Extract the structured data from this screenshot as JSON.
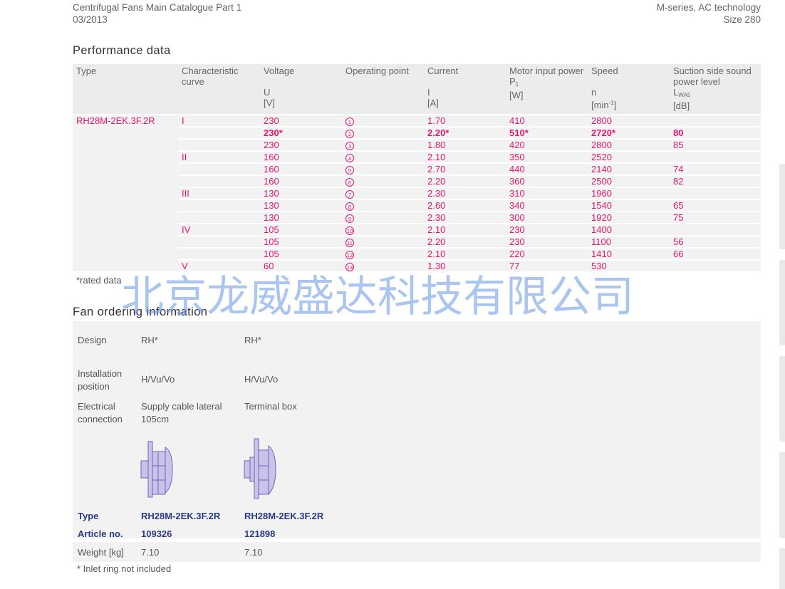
{
  "header": {
    "catalogue": "Centrifugal Fans Main Catalogue Part 1",
    "date": "03/2013",
    "series": "M-series, AC technology",
    "size": "Size 280"
  },
  "performance": {
    "title": "Performance data",
    "columns": {
      "type": "Type",
      "curve": "Characteristic curve",
      "voltage": {
        "label": "Voltage",
        "symbol": "U",
        "unit": "[V]"
      },
      "op": "Operating point",
      "current": {
        "label": "Current",
        "symbol": "I",
        "unit": "[A]"
      },
      "power": {
        "label": "Motor input power",
        "symbol": "P",
        "sub": "1",
        "unit": "[W]"
      },
      "speed": {
        "label": "Speed",
        "symbol": "n",
        "unit": "[min",
        "unit_sup": "-1",
        "unit_end": "]"
      },
      "sound": {
        "label": "Suction side sound power level",
        "symbol": "L",
        "sub": "WA5",
        "unit": "[dB]"
      }
    },
    "type_value": "RH28M-2EK.3F.2R",
    "rows": [
      {
        "curve": "I",
        "voltage": "230",
        "op": "1",
        "current": "1.70",
        "power": "410",
        "speed": "2800",
        "sound": ""
      },
      {
        "curve": "",
        "voltage": "230*",
        "op": "2",
        "current": "2.20*",
        "power": "510*",
        "speed": "2720*",
        "sound": "80",
        "bold": true
      },
      {
        "curve": "",
        "voltage": "230",
        "op": "3",
        "current": "1.80",
        "power": "420",
        "speed": "2800",
        "sound": "85"
      },
      {
        "curve": "II",
        "voltage": "160",
        "op": "4",
        "current": "2.10",
        "power": "350",
        "speed": "2520",
        "sound": ""
      },
      {
        "curve": "",
        "voltage": "160",
        "op": "5",
        "current": "2.70",
        "power": "440",
        "speed": "2140",
        "sound": "74"
      },
      {
        "curve": "",
        "voltage": "160",
        "op": "6",
        "current": "2.20",
        "power": "360",
        "speed": "2500",
        "sound": "82"
      },
      {
        "curve": "III",
        "voltage": "130",
        "op": "7",
        "current": "2.30",
        "power": "310",
        "speed": "1960",
        "sound": ""
      },
      {
        "curve": "",
        "voltage": "130",
        "op": "8",
        "current": "2.60",
        "power": "340",
        "speed": "1540",
        "sound": "65"
      },
      {
        "curve": "",
        "voltage": "130",
        "op": "9",
        "current": "2.30",
        "power": "300",
        "speed": "1920",
        "sound": "75"
      },
      {
        "curve": "IV",
        "voltage": "105",
        "op": "10",
        "current": "2.10",
        "power": "230",
        "speed": "1400",
        "sound": ""
      },
      {
        "curve": "",
        "voltage": "105",
        "op": "11",
        "current": "2.20",
        "power": "230",
        "speed": "1100",
        "sound": "56"
      },
      {
        "curve": "",
        "voltage": "105",
        "op": "12",
        "current": "2.10",
        "power": "220",
        "speed": "1410",
        "sound": "66"
      },
      {
        "curve": "V",
        "voltage": "60",
        "op": "13",
        "current": "1.30",
        "power": "77",
        "speed": "530",
        "sound": ""
      }
    ],
    "footnote": "*rated data"
  },
  "ordering": {
    "title": "Fan ordering information",
    "design_label": "Design",
    "design": [
      "RH*",
      "RH*"
    ],
    "installation_label": "Installation position",
    "installation": [
      "H/Vu/Vo",
      "H/Vu/Vo"
    ],
    "electrical_label": "Electrical connection",
    "electrical": [
      "Supply cable lateral 105cm",
      "Terminal box"
    ],
    "type_label": "Type",
    "types": [
      "RH28M-2EK.3F.2R",
      "RH28M-2EK.3F.2R"
    ],
    "article_label": "Article no.",
    "articles": [
      "109326",
      "121898"
    ],
    "weight_label": "Weight [kg]",
    "weights": [
      "7.10",
      "7.10"
    ],
    "footnote": "* Inlet ring not included"
  },
  "watermark": "北京龙威盛达科技有限公司",
  "colors": {
    "accent": "#e8156b",
    "navy": "#2a3a85",
    "fan_fill": "#c9c3ea",
    "fan_stroke": "#6b64b8"
  }
}
